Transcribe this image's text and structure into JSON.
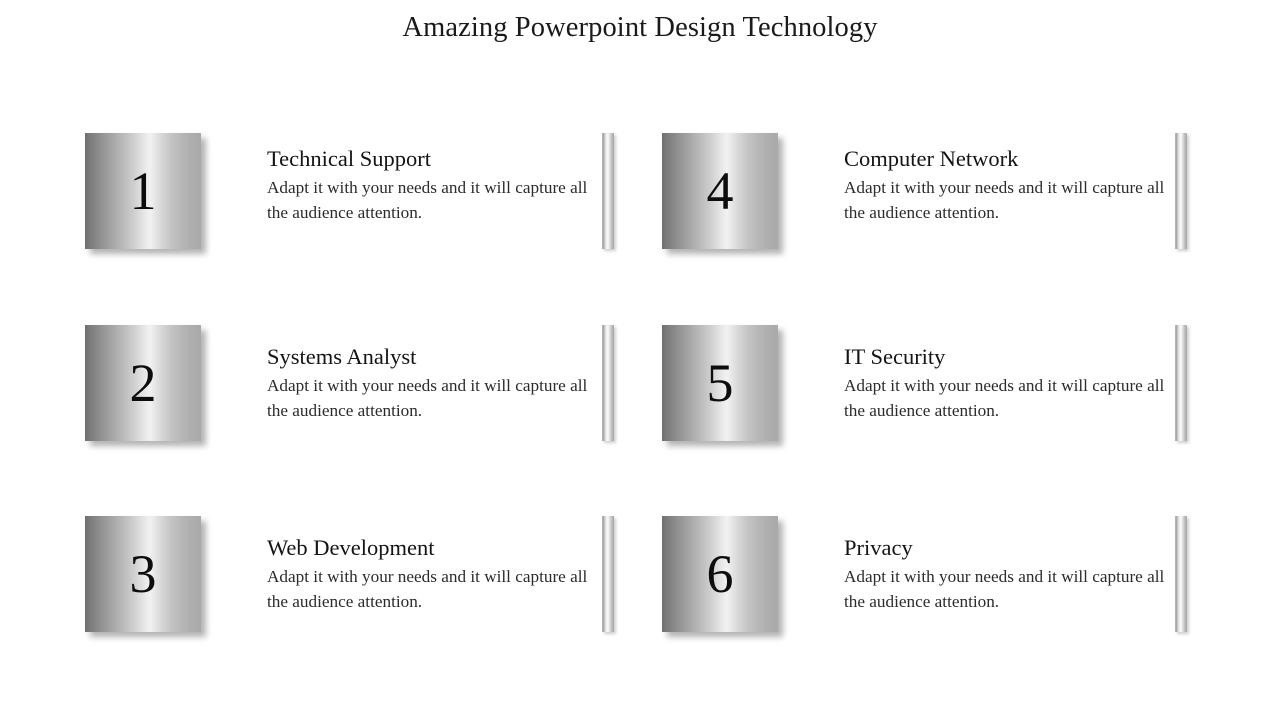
{
  "slide": {
    "title": "Amazing Powerpoint Design Technology",
    "background_color": "#ffffff",
    "text_color": "#161616"
  },
  "style": {
    "square_gradient_dark": "#6f6f6f",
    "square_gradient_highlight": "#f2f2f2",
    "square_gradient_mid": "#a9a9a9",
    "bar_highlight": "#fbfbfb",
    "bar_shadow": "#9f9f9f"
  },
  "items": [
    {
      "number": "1",
      "title": "Technical Support",
      "description": "Adapt it with your needs and it will capture all the audience attention."
    },
    {
      "number": "2",
      "title": "Systems Analyst",
      "description": "Adapt it with your needs and it will capture all the audience attention."
    },
    {
      "number": "3",
      "title": "Web Development",
      "description": "Adapt it with your needs and it will capture all the audience attention."
    },
    {
      "number": "4",
      "title": "Computer Network",
      "description": "Adapt it with your needs and it will capture all the audience attention."
    },
    {
      "number": "5",
      "title": "IT Security",
      "description": "Adapt it with your needs and it will capture all the audience attention."
    },
    {
      "number": "6",
      "title": "Privacy",
      "description": "Adapt it with your needs and it will capture all the audience attention."
    }
  ]
}
